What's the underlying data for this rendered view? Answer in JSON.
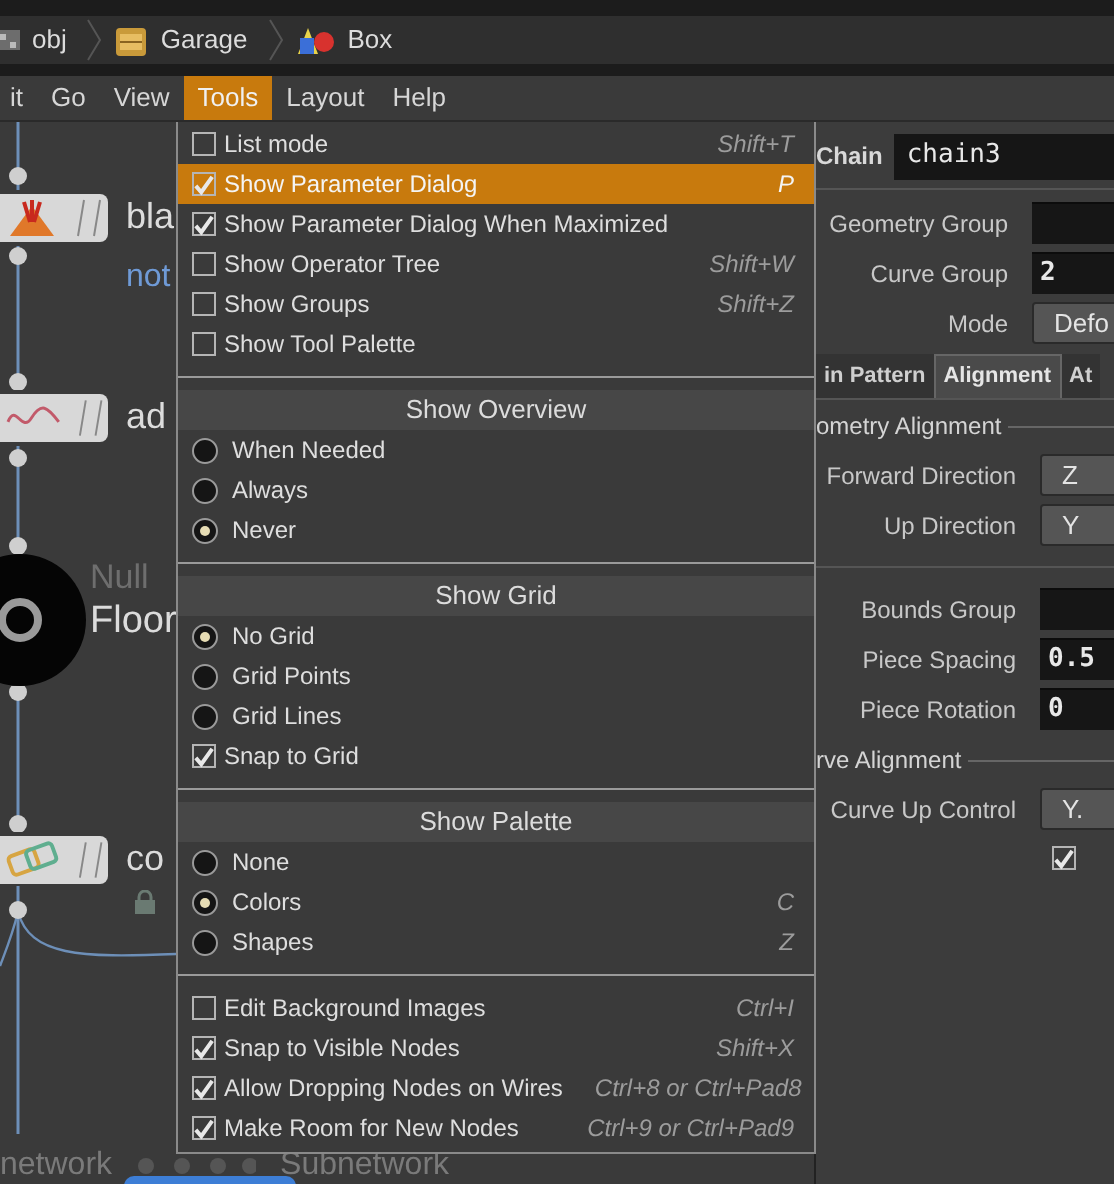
{
  "path_bar": [
    {
      "kind": "obj",
      "label": "obj"
    },
    {
      "kind": "garage",
      "label": "Garage"
    },
    {
      "kind": "box",
      "label": "Box"
    }
  ],
  "menu_bar": [
    {
      "label": "it",
      "selected": false
    },
    {
      "label": "Go",
      "selected": false
    },
    {
      "label": "View",
      "selected": false
    },
    {
      "label": "Tools",
      "selected": true
    },
    {
      "label": "Layout",
      "selected": false
    },
    {
      "label": "Help",
      "selected": false
    }
  ],
  "network": {
    "nodes": [
      {
        "kind": "blast",
        "name": "bla",
        "comment": "not"
      },
      {
        "kind": "add",
        "name": "ad"
      },
      {
        "kind": "null",
        "type": "Null",
        "name": "Floor"
      },
      {
        "kind": "connect",
        "name": "co",
        "locked": true
      }
    ],
    "bottom_labels": [
      "network",
      "Subnetwork"
    ]
  },
  "tools_menu": {
    "sections": [
      {
        "items": [
          {
            "kind": "check",
            "label": "List mode",
            "checked": false,
            "highlighted": false,
            "shortcut": "Shift+T"
          },
          {
            "kind": "check",
            "label": "Show Parameter Dialog",
            "checked": true,
            "highlighted": true,
            "shortcut": "P"
          },
          {
            "kind": "check",
            "label": "Show Parameter Dialog When Maximized",
            "checked": true,
            "highlighted": false
          },
          {
            "kind": "check",
            "label": "Show Operator Tree",
            "checked": false,
            "highlighted": false,
            "shortcut": "Shift+W"
          },
          {
            "kind": "check",
            "label": "Show Groups",
            "checked": false,
            "highlighted": false,
            "shortcut": "Shift+Z"
          },
          {
            "kind": "check",
            "label": "Show Tool Palette",
            "checked": false,
            "highlighted": false
          }
        ]
      },
      {
        "header": "Show Overview",
        "items": [
          {
            "kind": "radio",
            "label": "When Needed",
            "checked": false,
            "highlighted": false
          },
          {
            "kind": "radio",
            "label": "Always",
            "checked": false,
            "highlighted": false
          },
          {
            "kind": "radio",
            "label": "Never",
            "checked": true,
            "highlighted": false
          }
        ]
      },
      {
        "header": "Show Grid",
        "items": [
          {
            "kind": "radio",
            "label": "No Grid",
            "checked": true,
            "highlighted": false
          },
          {
            "kind": "radio",
            "label": "Grid Points",
            "checked": false,
            "highlighted": false
          },
          {
            "kind": "radio",
            "label": "Grid Lines",
            "checked": false,
            "highlighted": false
          },
          {
            "kind": "check",
            "label": "Snap to Grid",
            "checked": true,
            "highlighted": false
          }
        ]
      },
      {
        "header": "Show Palette",
        "items": [
          {
            "kind": "radio",
            "label": "None",
            "checked": false,
            "highlighted": false
          },
          {
            "kind": "radio",
            "label": "Colors",
            "checked": true,
            "highlighted": false,
            "shortcut": "C"
          },
          {
            "kind": "radio",
            "label": "Shapes",
            "checked": false,
            "highlighted": false,
            "shortcut": "Z"
          }
        ]
      },
      {
        "items": [
          {
            "kind": "check",
            "label": "Edit Background Images",
            "checked": false,
            "highlighted": false,
            "shortcut": "Ctrl+I"
          },
          {
            "kind": "check",
            "label": "Snap to Visible Nodes",
            "checked": true,
            "highlighted": false,
            "shortcut": "Shift+X"
          },
          {
            "kind": "check",
            "label": "Allow Dropping Nodes on Wires",
            "checked": true,
            "highlighted": false,
            "shortcut": "Ctrl+8 or Ctrl+Pad8"
          },
          {
            "kind": "check",
            "label": "Make Room for New Nodes",
            "checked": true,
            "highlighted": false,
            "shortcut": "Ctrl+9 or Ctrl+Pad9"
          }
        ]
      }
    ]
  },
  "parameters": {
    "node_type": "Chain",
    "node_name": "chain3",
    "top_rows": [
      {
        "kind": "field",
        "label": "Geometry Group",
        "value": ""
      },
      {
        "kind": "field",
        "label": "Curve Group",
        "value": "2"
      },
      {
        "kind": "menu",
        "label": "Mode",
        "value": "Defo"
      }
    ],
    "tabs": [
      {
        "label": "in Pattern",
        "selected": false
      },
      {
        "label": "Alignment",
        "selected": true
      },
      {
        "label": "At",
        "selected": false
      }
    ],
    "sections": [
      {
        "title": "ometry Alignment",
        "rows": [
          {
            "kind": "menu",
            "label": "Forward Direction",
            "value": "Z"
          },
          {
            "kind": "menu",
            "label": "Up Direction",
            "value": "Y"
          }
        ]
      },
      {
        "rows": [
          {
            "kind": "field",
            "label": "Bounds Group",
            "value": ""
          },
          {
            "kind": "field",
            "label": "Piece Spacing",
            "value": "0.5"
          },
          {
            "kind": "field",
            "label": "Piece Rotation",
            "value": "0"
          }
        ]
      },
      {
        "title": "rve Alignment",
        "rows": [
          {
            "kind": "menu",
            "label": "Curve Up Control",
            "value": "Y."
          },
          {
            "kind": "check",
            "checked": true
          }
        ]
      }
    ]
  }
}
